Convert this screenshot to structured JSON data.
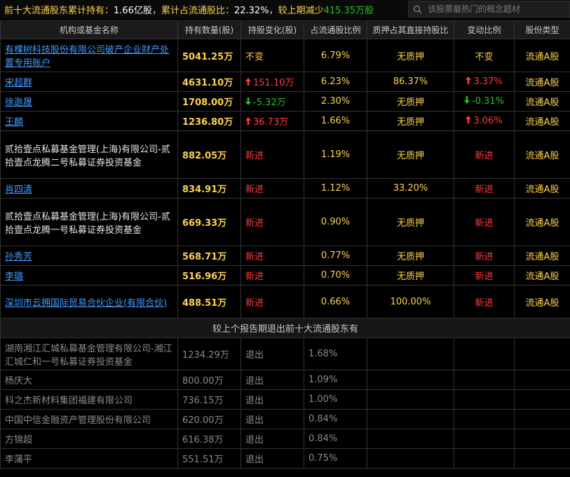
{
  "summary": {
    "prefix": "前十大流通股东累计持有：",
    "holding": "1.66亿股",
    "mid": "，累计占流通股比：",
    "ratio": "22.32%",
    "mid2": "，较上期减少",
    "change": "415.35万股"
  },
  "search": {
    "placeholder": "该股票最热门的概念题材"
  },
  "headers": [
    "机构或基金名称",
    "持有数量(股)",
    "持股变化(股)",
    "占流通股比例",
    "质押占其直接持股比",
    "变动比例",
    "股份类型"
  ],
  "holders": [
    {
      "name": "有棵树科技股份有限公司破产企业财产处置专用账户",
      "link": true,
      "qty": "5041.25万",
      "change": "不变",
      "change_dir": "none",
      "ratio": "6.79%",
      "pledge": "无质押",
      "var": "不变",
      "var_dir": "none",
      "type": "流通A股"
    },
    {
      "name": "宋超群",
      "link": true,
      "qty": "4631.10万",
      "change": "151.10万",
      "change_dir": "up",
      "ratio": "6.23%",
      "pledge": "86.37%",
      "var": "3.37%",
      "var_dir": "up",
      "type": "流通A股"
    },
    {
      "name": "徐逖晟",
      "link": true,
      "qty": "1708.00万",
      "change": "-5.32万",
      "change_dir": "down",
      "ratio": "2.30%",
      "pledge": "无质押",
      "var": "-0.31%",
      "var_dir": "down",
      "type": "流通A股"
    },
    {
      "name": "王麟",
      "link": true,
      "qty": "1236.80万",
      "change": "36.73万",
      "change_dir": "up",
      "ratio": "1.66%",
      "pledge": "无质押",
      "var": "3.06%",
      "var_dir": "up",
      "type": "流通A股"
    },
    {
      "name": "贰拾壹点私募基金管理(上海)有限公司-贰拾壹点龙腾二号私募证券投资基金",
      "link": false,
      "qty": "882.05万",
      "change": "新进",
      "change_dir": "new",
      "ratio": "1.19%",
      "pledge": "无质押",
      "var": "新进",
      "var_dir": "new",
      "type": "流通A股"
    },
    {
      "name": "肖四清",
      "link": true,
      "qty": "834.91万",
      "change": "新进",
      "change_dir": "new",
      "ratio": "1.12%",
      "pledge": "33.20%",
      "var": "新进",
      "var_dir": "new",
      "type": "流通A股"
    },
    {
      "name": "贰拾壹点私募基金管理(上海)有限公司-贰拾壹点龙腾一号私募证券投资基金",
      "link": false,
      "qty": "669.33万",
      "change": "新进",
      "change_dir": "new",
      "ratio": "0.90%",
      "pledge": "无质押",
      "var": "新进",
      "var_dir": "new",
      "type": "流通A股"
    },
    {
      "name": "孙秀芳",
      "link": true,
      "qty": "568.71万",
      "change": "新进",
      "change_dir": "new",
      "ratio": "0.77%",
      "pledge": "无质押",
      "var": "新进",
      "var_dir": "new",
      "type": "流通A股"
    },
    {
      "name": "李璐",
      "link": true,
      "qty": "516.96万",
      "change": "新进",
      "change_dir": "new",
      "ratio": "0.70%",
      "pledge": "无质押",
      "var": "新进",
      "var_dir": "new",
      "type": "流通A股"
    },
    {
      "name": "深圳市云拥国际贸易合伙企业(有限合伙)",
      "link": true,
      "qty": "488.51万",
      "change": "新进",
      "change_dir": "new",
      "ratio": "0.66%",
      "pledge": "100.00%",
      "var": "新进",
      "var_dir": "new",
      "type": "流通A股"
    }
  ],
  "exit_title": "较上个报告期退出前十大流通股东有",
  "exits": [
    {
      "name": "湖南湘江汇城私募基金管理有限公司-湘江汇城仁和一号私募证券投资基金",
      "qty": "1234.29万",
      "change": "退出",
      "ratio": "1.68%"
    },
    {
      "name": "杨庆大",
      "qty": "800.00万",
      "change": "退出",
      "ratio": "1.09%"
    },
    {
      "name": "科之杰新材料集团福建有限公司",
      "qty": "736.15万",
      "change": "退出",
      "ratio": "1.00%"
    },
    {
      "name": "中国中信金融资产管理股份有限公司",
      "qty": "620.00万",
      "change": "退出",
      "ratio": "0.84%"
    },
    {
      "name": "方锦超",
      "qty": "616.38万",
      "change": "退出",
      "ratio": "0.84%"
    },
    {
      "name": "李蒲平",
      "qty": "551.51万",
      "change": "退出",
      "ratio": "0.75%"
    }
  ]
}
